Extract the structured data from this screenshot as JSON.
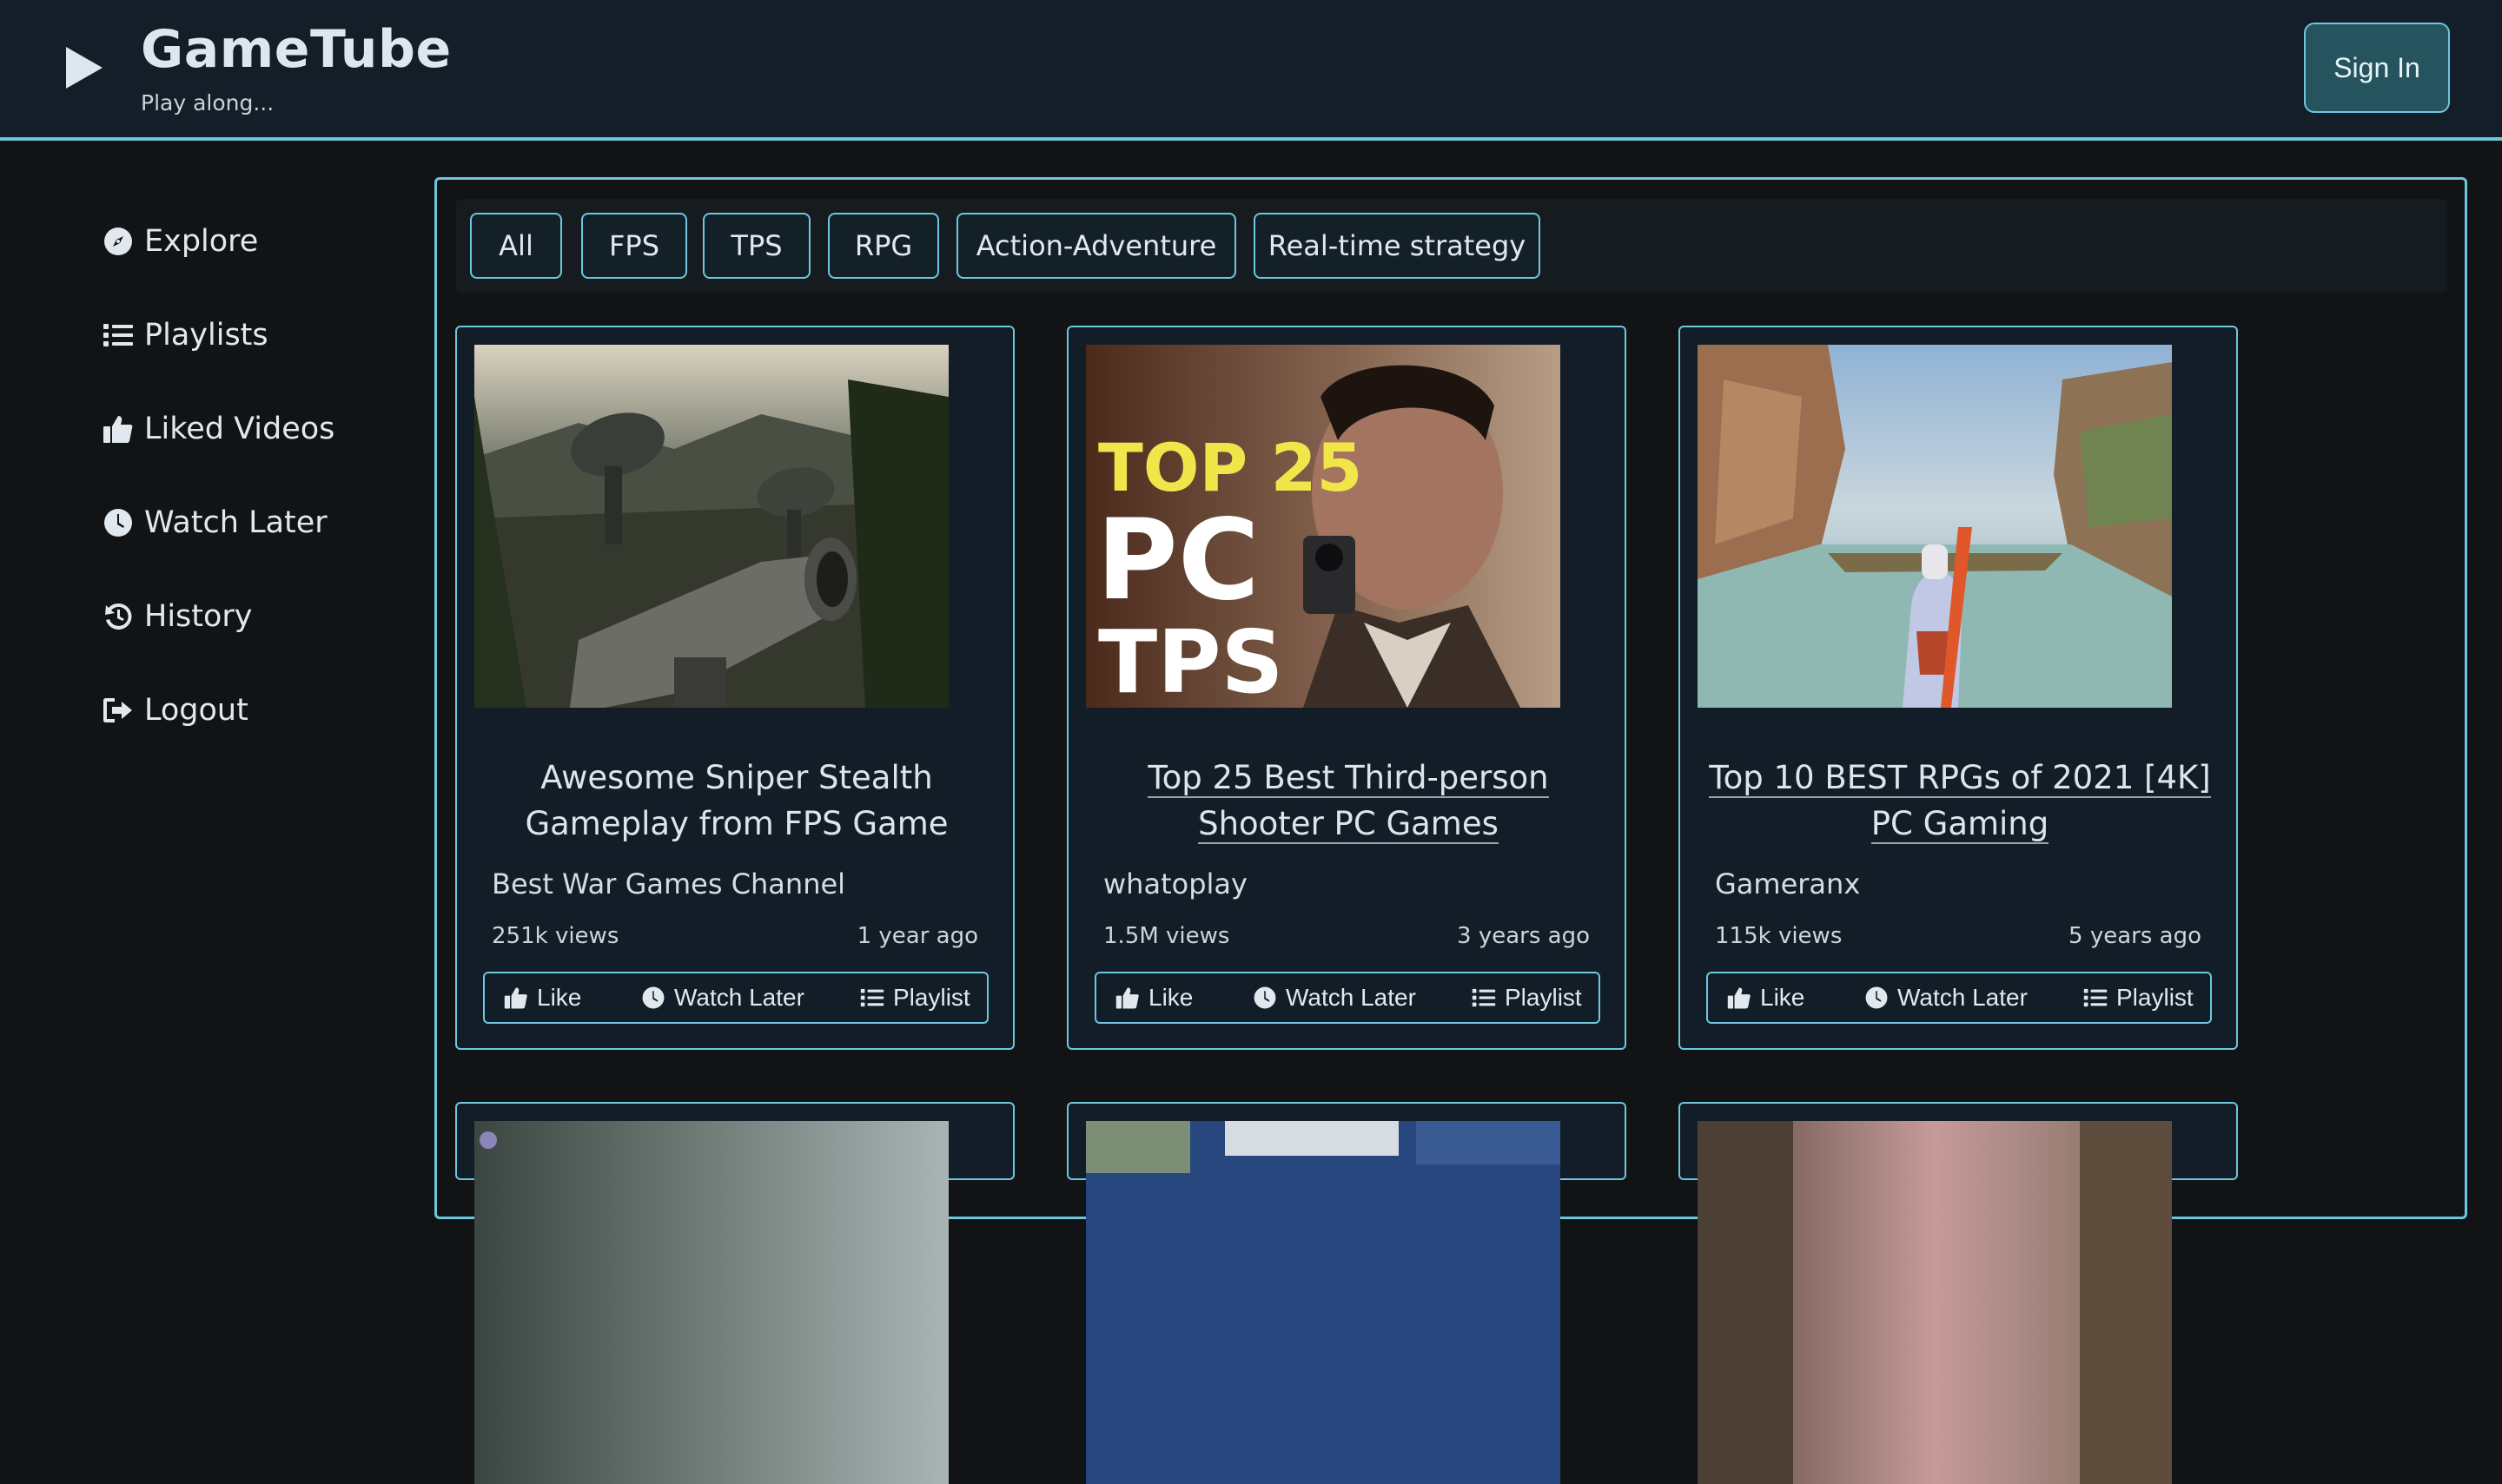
{
  "header": {
    "brand": "GameTube",
    "tagline": "Play along...",
    "sign_in": "Sign In"
  },
  "sidebar": {
    "items": [
      {
        "label": "Explore",
        "icon": "compass-icon"
      },
      {
        "label": "Playlists",
        "icon": "list-icon"
      },
      {
        "label": "Liked Videos",
        "icon": "thumbs-up-icon"
      },
      {
        "label": "Watch Later",
        "icon": "clock-icon"
      },
      {
        "label": "History",
        "icon": "history-icon"
      },
      {
        "label": "Logout",
        "icon": "logout-icon"
      }
    ]
  },
  "filters": [
    "All",
    "FPS",
    "TPS",
    "RPG",
    "Action-Adventure",
    "Real-time strategy"
  ],
  "videos": [
    {
      "title": "Awesome Sniper Stealth Gameplay from FPS Game",
      "channel": "Best War Games Channel",
      "views": "251k views",
      "age": "1 year ago"
    },
    {
      "title": "Top 25 Best Third-person Shooter PC Games",
      "channel": "whatoplay",
      "views": "1.5M views",
      "age": "3 years ago",
      "thumb_text": [
        "TOP 25",
        "PC",
        "TPS"
      ]
    },
    {
      "title": "Top 10 BEST RPGs of 2021 [4K] PC Gaming",
      "channel": "Gameranx",
      "views": "115k views",
      "age": "5 years ago"
    }
  ],
  "card_actions": {
    "like": "Like",
    "watch_later": "Watch Later",
    "playlist": "Playlist"
  },
  "colors": {
    "accent": "#6cc7df",
    "header_bg": "#131e29",
    "card_bg": "#131d28",
    "page_bg": "#111315"
  }
}
